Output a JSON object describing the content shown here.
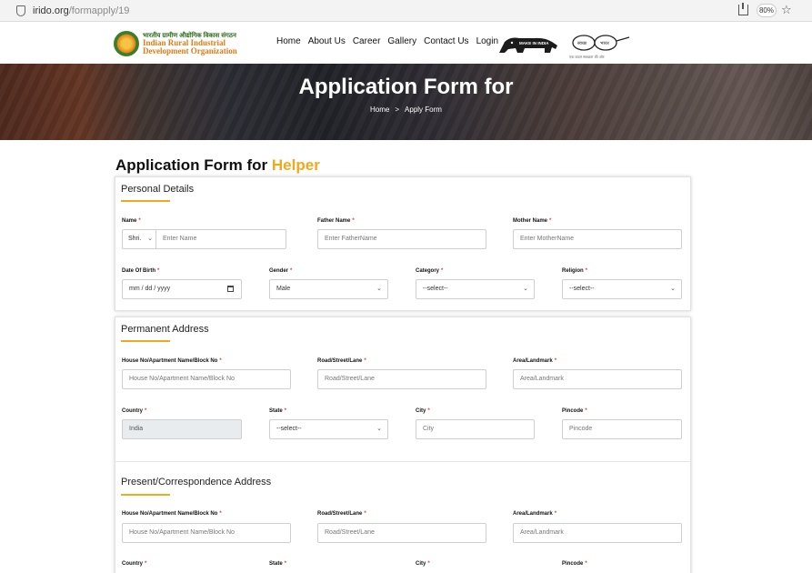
{
  "browser": {
    "url_host": "irido.org",
    "url_path": "/formapply/19",
    "zoom": "80%"
  },
  "header": {
    "logo": {
      "hindi": "भारतीय ग्रामीण औद्योगिक विकास संगठन",
      "line1": "Indian Rural Industrial",
      "line2": "Development Organization"
    },
    "nav": [
      "Home",
      "About Us",
      "Career",
      "Gallery",
      "Contact Us",
      "Login"
    ],
    "make_in_india": "MAKE IN INDIA",
    "swachh": {
      "left": "स्वच्छ",
      "right": "भारत",
      "caption": "एक कदम स्वच्छता की ओर"
    }
  },
  "banner": {
    "title": "Application Form for",
    "breadcrumb_home": "Home",
    "breadcrumb_sep": ">",
    "breadcrumb_current": "Apply Form"
  },
  "form": {
    "heading_prefix": "Application Form for",
    "heading_accent": "Helper",
    "personal": {
      "title": "Personal Details",
      "name_label": "Name",
      "name_prefix": "Shri.",
      "name_placeholder": "Enter Name",
      "father_label": "Father Name",
      "father_placeholder": "Enter FatherName",
      "mother_label": "Mother Name",
      "mother_placeholder": "Enter MotherName",
      "dob_label": "Date Of Birth",
      "dob_placeholder": "mm / dd / yyyy",
      "gender_label": "Gender",
      "gender_value": "Male",
      "category_label": "Category",
      "category_value": "--select--",
      "religion_label": "Religion",
      "religion_value": "--select--"
    },
    "permanent": {
      "title": "Permanent Address",
      "house_label": "House No/Apartment Name/Block No",
      "house_placeholder": "House No/Apartment Name/Block No",
      "street_label": "Road/Street/Lane",
      "street_placeholder": "Road/Street/Lane",
      "area_label": "Area/Landmark",
      "area_placeholder": "Area/Landmark",
      "country_label": "Country",
      "country_value": "India",
      "state_label": "State",
      "state_value": "--select--",
      "city_label": "City",
      "city_placeholder": "City",
      "pincode_label": "Pincode",
      "pincode_placeholder": "Pincode"
    },
    "present": {
      "title": "Present/Correspondence Address",
      "house_label": "House No/Apartment Name/Block No",
      "house_placeholder": "House No/Apartment Name/Block No",
      "street_label": "Road/Street/Lane",
      "street_placeholder": "Road/Street/Lane",
      "area_label": "Area/Landmark",
      "area_placeholder": "Area/Landmark",
      "country_label": "Country",
      "state_label": "State",
      "city_label": "City",
      "pincode_label": "Pincode"
    },
    "required_mark": "*"
  }
}
